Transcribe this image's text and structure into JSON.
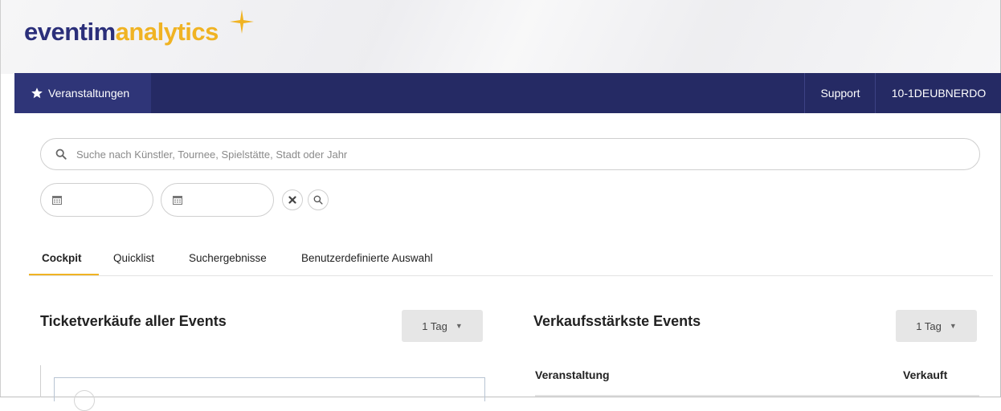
{
  "brand": {
    "part1": "eventim",
    "part2": "analytics",
    "accent": "#f0b323",
    "primary": "#2b2f7a"
  },
  "navbar": {
    "left_item": {
      "icon": "star-icon",
      "label": "Veranstaltungen"
    },
    "support_label": "Support",
    "user_label": "10-1DEUBNERDO",
    "bg_color": "#252a64"
  },
  "search": {
    "placeholder": "Suche nach Künstler, Tournee, Spielstätte, Stadt oder Jahr",
    "value": "",
    "icon": "search-icon"
  },
  "date_filters": [
    {
      "icon": "calendar-icon",
      "value": ""
    },
    {
      "icon": "calendar-icon",
      "value": ""
    }
  ],
  "action_buttons": [
    {
      "icon": "close-icon"
    },
    {
      "icon": "search-icon"
    }
  ],
  "tabs": [
    {
      "label": "Cockpit",
      "active": true
    },
    {
      "label": "Quicklist",
      "active": false
    },
    {
      "label": "Suchergebnisse",
      "active": false
    },
    {
      "label": "Benutzerdefinierte Auswahl",
      "active": false
    }
  ],
  "left_panel": {
    "title": "Ticketverkäufe aller Events",
    "range_label": "1 Tag"
  },
  "right_panel": {
    "title": "Verkaufsstärkste Events",
    "range_label": "1 Tag",
    "table_headers": [
      "Veranstaltung",
      "Verkauft"
    ]
  }
}
